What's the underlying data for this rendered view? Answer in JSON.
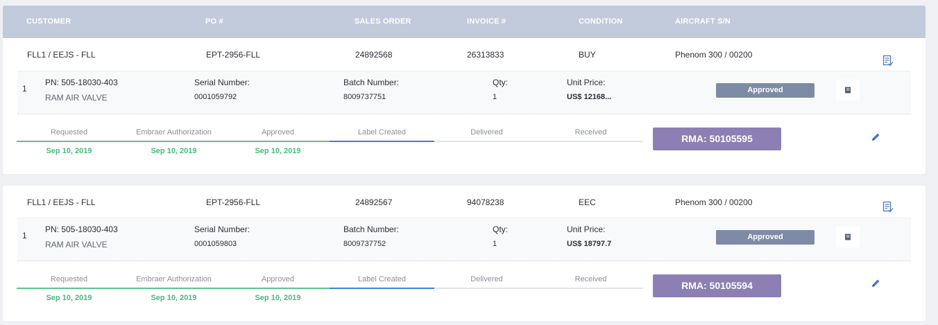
{
  "header": {
    "customer": "CUSTOMER",
    "po": "PO #",
    "sales_order": "SALES ORDER",
    "invoice": "INVOICE #",
    "condition": "CONDITION",
    "aircraft_sn": "AIRCRAFT S/N"
  },
  "orders": [
    {
      "customer": "FLL1 / EEJS - FLL",
      "po": "EPT-2956-FLL",
      "sales_order": "24892568",
      "invoice": "26313833",
      "condition": "BUY",
      "aircraft_sn": "Phenom 300 / 00200",
      "item": {
        "index": "1",
        "pn": "PN: 505-18030-403",
        "description": "RAM AIR VALVE",
        "serial_label": "Serial Number:",
        "serial_value": "0001059792",
        "batch_label": "Batch Number:",
        "batch_value": "8009737751",
        "qty_label": "Qty:",
        "qty_value": "1",
        "price_label": "Unit Price:",
        "price_value": "US$ 12168...",
        "status": "Approved"
      },
      "steps": [
        {
          "label": "Requested",
          "date": "Sep 10, 2019"
        },
        {
          "label": "Embraer Authorization",
          "date": "Sep 10, 2019"
        },
        {
          "label": "Approved",
          "date": "Sep 10, 2019"
        },
        {
          "label": "Label Created",
          "date": ""
        },
        {
          "label": "Delivered",
          "date": ""
        },
        {
          "label": "Received",
          "date": ""
        }
      ],
      "rma": "RMA: 50105595"
    },
    {
      "customer": "FLL1 / EEJS - FLL",
      "po": "EPT-2956-FLL",
      "sales_order": "24892567",
      "invoice": "94078238",
      "condition": "EEC",
      "aircraft_sn": "Phenom 300 / 00200",
      "item": {
        "index": "1",
        "pn": "PN: 505-18030-403",
        "description": "RAM AIR VALVE",
        "serial_label": "Serial Number:",
        "serial_value": "0001059803",
        "batch_label": "Batch Number:",
        "batch_value": "8009737752",
        "qty_label": "Qty:",
        "qty_value": "1",
        "price_label": "Unit Price:",
        "price_value": "US$ 18797.7",
        "status": "Approved"
      },
      "steps": [
        {
          "label": "Requested",
          "date": "Sep 10, 2019"
        },
        {
          "label": "Embraer Authorization",
          "date": "Sep 10, 2019"
        },
        {
          "label": "Approved",
          "date": "Sep 10, 2019"
        },
        {
          "label": "Label Created",
          "date": ""
        },
        {
          "label": "Delivered",
          "date": ""
        },
        {
          "label": "Received",
          "date": ""
        }
      ],
      "rma": "RMA: 50105594"
    }
  ],
  "icons": {
    "notes": "notes-check-icon",
    "book": "book-icon",
    "edit": "pencil-icon"
  },
  "colors": {
    "header_bg": "#c2cbdb",
    "done": "#5cc28a",
    "current": "#3b82d6",
    "approved_badge": "#7e8ba6",
    "rma": "#8d7fb3",
    "icon": "#4a78c2"
  }
}
